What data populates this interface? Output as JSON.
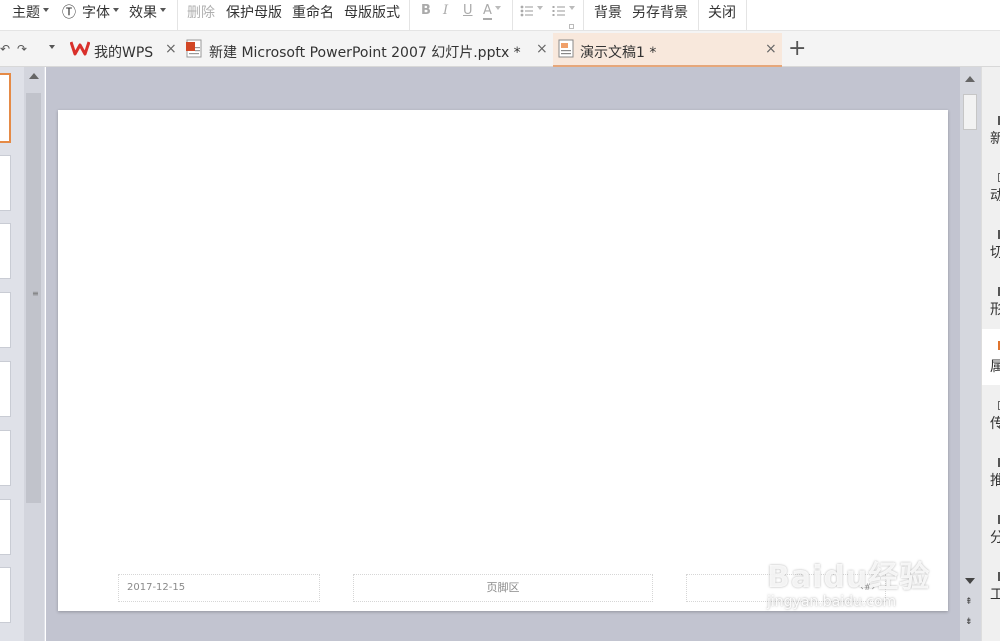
{
  "ribbon": {
    "theme": "主题",
    "font_glyph": "Ⓣ",
    "font": "字体",
    "effect": "效果",
    "delete": "删除",
    "protect_master": "保护母版",
    "rename": "重命名",
    "master_layout": "母版版式",
    "bold": "B",
    "italic": "I",
    "underline": "U",
    "font_color": "A",
    "background": "背景",
    "save_background": "另存背景",
    "close": "关闭"
  },
  "tabs": [
    {
      "label": "我的WPS",
      "icon": "wps-logo-icon",
      "close": "×"
    },
    {
      "label": "新建 Microsoft PowerPoint 2007 幻灯片.pptx *",
      "icon": "ppt-file-icon",
      "close": "×"
    },
    {
      "label": "演示文稿1 *",
      "icon": "presentation-doc-icon",
      "close": "×",
      "active": true
    }
  ],
  "tab_add": "+",
  "slide": {
    "date": "2017-12-15",
    "footer": "页脚区",
    "number": "‹#›"
  },
  "task_pane": [
    {
      "label": "新",
      "icon": "new-icon"
    },
    {
      "label": "动",
      "icon": "animation-icon"
    },
    {
      "label": "切",
      "icon": "transition-icon"
    },
    {
      "label": "形",
      "icon": "shape-icon"
    },
    {
      "label": "属",
      "icon": "property-icon",
      "active": true
    },
    {
      "label": "传",
      "icon": "upload-icon"
    },
    {
      "label": "推",
      "icon": "recommend-icon"
    },
    {
      "label": "分",
      "icon": "share-icon"
    },
    {
      "label": "工",
      "icon": "tools-icon"
    }
  ],
  "watermark": {
    "logo": "Baidu经验",
    "url": "jingyan.baidu.com"
  },
  "colors": {
    "accent": "#e58a46",
    "active_tab": "#f8e8dc",
    "canvas": "#c2c4d0",
    "wps_red": "#d9302b"
  }
}
